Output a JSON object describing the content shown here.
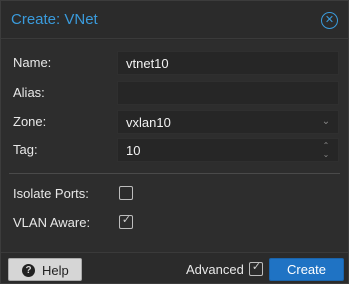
{
  "dialog": {
    "title": "Create: VNet",
    "close_icon": "close-circle-icon"
  },
  "form": {
    "name": {
      "label": "Name:",
      "value": "vtnet10"
    },
    "alias": {
      "label": "Alias:",
      "value": ""
    },
    "zone": {
      "label": "Zone:",
      "value": "vxlan10",
      "trigger_icon": "chevron-down-icon"
    },
    "tag": {
      "label": "Tag:",
      "value": "10",
      "spinner_icon": "spinner-icon"
    },
    "isolate_ports": {
      "label": "Isolate Ports:",
      "checked": false
    },
    "vlan_aware": {
      "label": "VLAN Aware:",
      "checked": true
    }
  },
  "footer": {
    "help_label": "Help",
    "help_icon": "question-circle-icon",
    "advanced_label": "Advanced",
    "advanced_checked": true,
    "create_label": "Create"
  },
  "colors": {
    "accent": "#3a9bdc",
    "primary_button": "#1f73c4",
    "background": "#2b2b2b"
  }
}
